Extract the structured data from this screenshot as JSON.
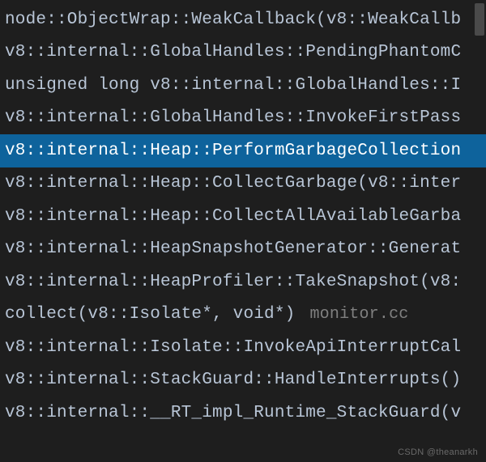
{
  "stack": {
    "frames": [
      {
        "text": "node::ObjectWrap::WeakCallback(v8::WeakCallb",
        "selected": false,
        "source": ""
      },
      {
        "text": "v8::internal::GlobalHandles::PendingPhantomC",
        "selected": false,
        "source": ""
      },
      {
        "text": "unsigned long v8::internal::GlobalHandles::I",
        "selected": false,
        "source": ""
      },
      {
        "text": "v8::internal::GlobalHandles::InvokeFirstPass",
        "selected": false,
        "source": ""
      },
      {
        "text": "v8::internal::Heap::PerformGarbageCollection",
        "selected": true,
        "source": ""
      },
      {
        "text": "v8::internal::Heap::CollectGarbage(v8::inter",
        "selected": false,
        "source": ""
      },
      {
        "text": "v8::internal::Heap::CollectAllAvailableGarba",
        "selected": false,
        "source": ""
      },
      {
        "text": "v8::internal::HeapSnapshotGenerator::Generat",
        "selected": false,
        "source": ""
      },
      {
        "text": "v8::internal::HeapProfiler::TakeSnapshot(v8:",
        "selected": false,
        "source": ""
      },
      {
        "text": "collect(v8::Isolate*, void*)",
        "selected": false,
        "source": "monitor.cc"
      },
      {
        "text": "v8::internal::Isolate::InvokeApiInterruptCal",
        "selected": false,
        "source": ""
      },
      {
        "text": "v8::internal::StackGuard::HandleInterrupts()",
        "selected": false,
        "source": ""
      },
      {
        "text": "v8::internal::__RT_impl_Runtime_StackGuard(v",
        "selected": false,
        "source": ""
      }
    ]
  },
  "watermark": "CSDN @theanarkh"
}
